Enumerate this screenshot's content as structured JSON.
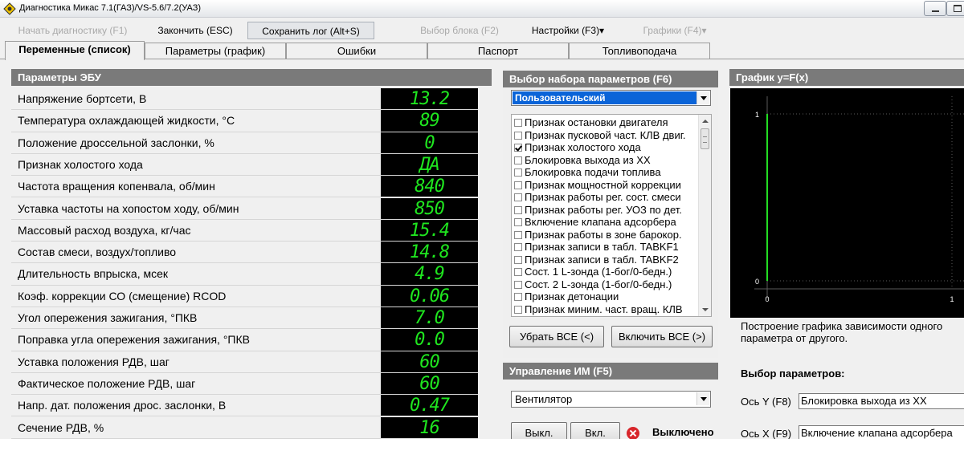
{
  "window": {
    "title": "Диагностика Микас 7.1(ГАЗ)/VS-5.6/7.2(УАЗ)"
  },
  "toolbar": {
    "start": "Начать диагностику (F1)",
    "finish": "Закончить (ESC)",
    "save_log": "Сохранить лог (Alt+S)",
    "block_select": "Выбор блока (F2)",
    "settings": "Настройки (F3)▾",
    "charts": "Графики (F4)▾"
  },
  "tabs": [
    {
      "label": "Переменные (список)",
      "active": true
    },
    {
      "label": "Параметры (график)"
    },
    {
      "label": "Ошибки"
    },
    {
      "label": "Паспорт"
    },
    {
      "label": "Топливоподача"
    }
  ],
  "ecu": {
    "title": "Параметры ЭБУ",
    "rows": [
      {
        "label": "Напряжение бортсети, В",
        "value": "13.2"
      },
      {
        "label": "Температура охлаждающей жидкости, °С",
        "value": "89"
      },
      {
        "label": "Положение дроссельной заслонки, %",
        "value": "0"
      },
      {
        "label": "Признак холостого хода",
        "value": "ДА"
      },
      {
        "label": "Частота вращения копенвала, об/мин",
        "value": "840"
      },
      {
        "label": "Уставка частоты на хопостом ходу, об/мин",
        "value": "850"
      },
      {
        "label": "Массовый расход  воздуха, кг/час",
        "value": "15.4"
      },
      {
        "label": "Состав смеси, воздух/топливо",
        "value": "14.8"
      },
      {
        "label": "Длительность впрыска, мсек",
        "value": "4.9"
      },
      {
        "label": "Коэф. коррекции СО (смещение) RCOD",
        "value": "0.06"
      },
      {
        "label": "Угол опережения зажигания, °ПКВ",
        "value": "7.0"
      },
      {
        "label": "Поправка угла опережения зажигания, °ПКВ",
        "value": "0.0"
      },
      {
        "label": "Уставка положения РДВ, шаг",
        "value": "60"
      },
      {
        "label": "Фактическое положение РДВ, шаг",
        "value": "60"
      },
      {
        "label": "Напр. дат. положения дрос. заслонки, В",
        "value": "0.47"
      },
      {
        "label": "Сечение РДВ, %",
        "value": "16"
      }
    ]
  },
  "param_select": {
    "title": "Выбор набора параметров (F6)",
    "selected_set": "Пользовательский",
    "items": [
      {
        "label": "Признак остановки двигателя",
        "checked": false
      },
      {
        "label": "Признак пусковой част. КЛВ двиг.",
        "checked": false
      },
      {
        "label": "Признак холостого хода",
        "checked": true
      },
      {
        "label": "Блокировка выхода из ХХ",
        "checked": false
      },
      {
        "label": "Блокировка подачи топлива",
        "checked": false
      },
      {
        "label": "Признак мощностной коррекции",
        "checked": false
      },
      {
        "label": "Признак работы рег. сост. смеси",
        "checked": false
      },
      {
        "label": "Признак работы рег. УОЗ по дет.",
        "checked": false
      },
      {
        "label": "Включение клапана адсорбера",
        "checked": false
      },
      {
        "label": "Признак работы в зоне барокор.",
        "checked": false
      },
      {
        "label": "Признак записи в табл. TABKF1",
        "checked": false
      },
      {
        "label": "Признак записи в табл. TABKF2",
        "checked": false
      },
      {
        "label": "Сост. 1 L-зонда (1-бог/0-бедн.)",
        "checked": false
      },
      {
        "label": "Сост. 2 L-зонда (1-бог/0-бедн.)",
        "checked": false
      },
      {
        "label": "Признак детонации",
        "checked": false
      },
      {
        "label": "Признак миним. част. вращ. КЛВ",
        "checked": false
      }
    ],
    "remove_all": "Убрать ВСЕ (<)",
    "include_all": "Включить ВСЕ (>)"
  },
  "im_control": {
    "title": "Управление ИМ (F5)",
    "selected": "Вентилятор",
    "off_label": "Выкл.",
    "on_label": "Вкл.",
    "status": "Выключено"
  },
  "graph": {
    "title": "График y=F(x)",
    "description": "Построение графика зависимости одного параметра от другого.",
    "select_title": "Выбор параметров:",
    "axis_y_label": "Ось Y (F8)",
    "axis_y_value": "Блокировка выхода из ХХ",
    "axis_x_label": "Ось X (F9)",
    "axis_x_value": "Включение клапана адсорбера",
    "colors": {
      "line": "#22dd22",
      "background": "#000000",
      "grid": "#5a5a5a",
      "text": "#ffffff"
    }
  },
  "chart_data": {
    "type": "line",
    "title": "",
    "xlabel": "",
    "ylabel": "",
    "xlim": [
      0,
      1
    ],
    "ylim": [
      0,
      1
    ],
    "x_ticks": [
      "0",
      "1"
    ],
    "y_ticks": [
      "0",
      "1"
    ],
    "grid": true,
    "series": [
      {
        "x": [
          0,
          0
        ],
        "y": [
          0,
          1
        ]
      }
    ]
  }
}
